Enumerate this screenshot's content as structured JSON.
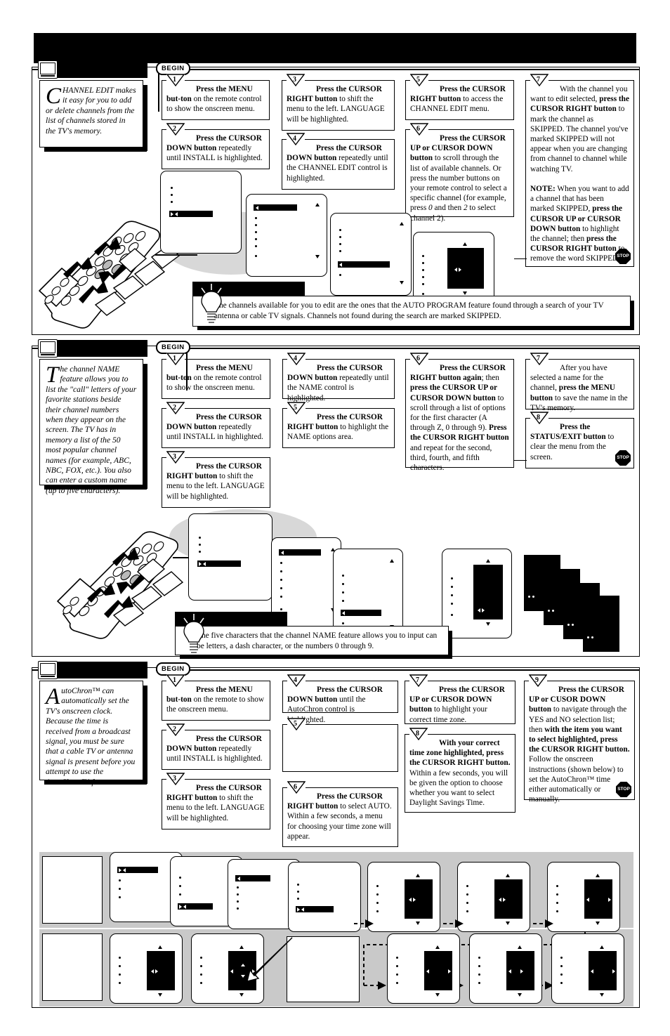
{
  "page": {
    "banner_redacted": true,
    "begin_label": "BEGIN",
    "stop_label": "STOP"
  },
  "sections": [
    {
      "id": "channel-edit",
      "title_redacted": true,
      "intro": {
        "dropcap": "C",
        "text": "HANNEL EDIT makes it easy for you to add or delete channels from the list of channels stored in the TV's memory."
      },
      "steps": [
        {
          "n": "1",
          "html": "<b>Press the MENU but-ton</b> on the remote control to show the onscreen menu."
        },
        {
          "n": "2",
          "html": "<b>Press the CURSOR DOWN button</b> repeatedly until INSTALL is highlighted."
        },
        {
          "n": "3",
          "html": "<b>Press the CURSOR RIGHT button</b> to shift the menu to the left. LANGUAGE will be highlighted."
        },
        {
          "n": "4",
          "html": "<b>Press the CURSOR DOWN button</b> repeatedly until the CHANNEL EDIT control is highlighted."
        },
        {
          "n": "5",
          "html": "<b>Press the CURSOR RIGHT button</b> to access the CHANNEL EDIT menu."
        },
        {
          "n": "6",
          "html": "<b>Press the CURSOR UP or CURSOR DOWN button</b> to scroll through the list of available channels.  Or press the number buttons on your remote control to select a specific channel (for example, press <i>0</i> and then <i>2</i> to select channel 2)."
        },
        {
          "n": "7",
          "html": "With the channel you want to edit selected, <b>press the CURSOR RIGHT button</b> to mark the channel as SKIPPED. The channel you've marked SKIPPED will not appear when you are changing from channel to channel while watching TV.<br><br><b>NOTE:</b>  When you want to add a channel that has been marked SKIPPED, <b>press the CURSOR UP or CURSOR DOWN button</b> to highlight the channel; then <b>press the CURSOR RIGHT button</b> to remove the word SKIPPED."
        }
      ],
      "hint": {
        "header_redacted": true,
        "text": "The channels available for you to edit are the ones that the AUTO PROGRAM feature found through a search of your TV antenna or cable TV signals.  Channels not found during the search are marked SKIPPED."
      }
    },
    {
      "id": "channel-name",
      "title_redacted": true,
      "intro": {
        "dropcap": "T",
        "text": "he channel NAME feature allows you to list the \"call\" letters of your favorite stations beside their channel numbers when they appear on the screen.  The TV has in memory a list of the 50 most popular channel names (for example, ABC, NBC, FOX, etc.).  You also can enter a custom name (up to five characters)."
      },
      "steps": [
        {
          "n": "1",
          "html": "<b>Press the MENU but-ton</b> on the remote control to show the onscreen menu."
        },
        {
          "n": "2",
          "html": "<b>Press the CURSOR DOWN button</b> repeatedly until INSTALL in highlighted."
        },
        {
          "n": "3",
          "html": "<b>Press the CURSOR RIGHT button</b> to shift the menu to the left. LANGUAGE will be highlighted."
        },
        {
          "n": "4",
          "html": "<b>Press the CURSOR DOWN button</b> repeatedly until the NAME control is highlighted."
        },
        {
          "n": "5",
          "html": "<b>Press the CURSOR RIGHT button</b> to highlight the NAME options area."
        },
        {
          "n": "6",
          "html": "<b>Press the CURSOR RIGHT button again</b>; then <b>press the CURSOR UP or CURSOR DOWN button</b> to scroll through a list of options for the first character (A through Z, 0 through 9).  <b>Press the CURSOR RIGHT button</b> and repeat for the second, third, fourth, and fifth characters."
        },
        {
          "n": "7",
          "html": "After you have selected a name for the channel, <b>press the MENU button</b> to save the name in the TV's memory."
        },
        {
          "n": "8",
          "html": "<b>Press the STATUS/EXIT button</b> to clear the menu from the screen."
        }
      ],
      "hint": {
        "header_redacted": true,
        "text": "The five characters that the channel NAME feature allows you to input can be letters, a dash character, or the numbers 0 through 9."
      }
    },
    {
      "id": "autochron",
      "title_redacted": true,
      "intro": {
        "dropcap": "A",
        "text": "utoChron™ can automatically set the TV's onscreen clock.  Because the time is received from a broadcast signal, you must be sure that a cable TV or antenna signal is present before you attempt to use the AutoChron™ feature."
      },
      "steps": [
        {
          "n": "1",
          "html": "<b>Press the MENU but-ton</b> on the remote to show the onscreen menu."
        },
        {
          "n": "2",
          "html": "<b>Press the CURSOR DOWN button</b> repeatedly until INSTALL is highlighted."
        },
        {
          "n": "3",
          "html": "<b>Press the CURSOR RIGHT button</b> to shift the menu to the left. LANGUAGE will be highlighted."
        },
        {
          "n": "4",
          "html": "<b>Press the CURSOR DOWN button</b> until the AutoChron control is highlighted."
        },
        {
          "n": "5",
          "html": ""
        },
        {
          "n": "6",
          "html": "<b>Press the CURSOR RIGHT button</b> to select AUTO. Within a few seconds, a menu for choosing your time zone will appear."
        },
        {
          "n": "7",
          "html": "<b>Press the CURSOR UP or CURSOR DOWN button</b> to highlight your correct time zone."
        },
        {
          "n": "8",
          "html": "<b>With your correct time zone highlighted, press the CURSOR RIGHT button.</b> Within a few seconds, you will be given the option to choose whether you want to select Daylight Savings Time."
        },
        {
          "n": "9",
          "html": "<b>Press the CURSOR UP or CUSOR DOWN button</b> to navigate through the YES and NO selection list; then <b>with the item you want to select highlighted, press the CURSOR RIGHT button.</b> Follow the onscreen instructions (shown below) to set the AutoChron™ time either automatically or manually."
        }
      ]
    }
  ]
}
